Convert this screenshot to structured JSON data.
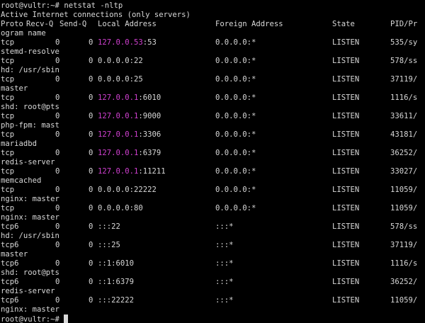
{
  "terminal": {
    "prompt": "root@vultr:~#",
    "command": "netstat -nltp",
    "title_line": "Active Internet connections (only servers)",
    "colors": {
      "background": "#000000",
      "foreground": "#d8d8d8",
      "local_ip_highlight": "#d040d0"
    }
  },
  "table": {
    "headers": {
      "proto": "Proto",
      "recvq": "Recv-Q",
      "sendq": "Send-Q",
      "local": "Local Address",
      "foreign": "Foreign Address",
      "state": "State",
      "pid": "PID/Pr",
      "pid_wrap": "ogram name"
    },
    "rows": [
      {
        "proto": "tcp",
        "recvq": "0",
        "sendq": "0",
        "local_ip": "127.0.0.53",
        "local_port": ":53",
        "foreign": "0.0.0.0:*",
        "state": "LISTEN",
        "pid": "535/sy",
        "wrap": "stemd-resolve"
      },
      {
        "proto": "tcp",
        "recvq": "0",
        "sendq": "0",
        "local_ip": "",
        "local_port": "0.0.0.0:22",
        "foreign": "0.0.0.0:*",
        "state": "LISTEN",
        "pid": "578/ss",
        "wrap": "hd: /usr/sbin"
      },
      {
        "proto": "tcp",
        "recvq": "0",
        "sendq": "0",
        "local_ip": "",
        "local_port": "0.0.0.0:25",
        "foreign": "0.0.0.0:*",
        "state": "LISTEN",
        "pid": "37119/",
        "wrap": "master"
      },
      {
        "proto": "tcp",
        "recvq": "0",
        "sendq": "0",
        "local_ip": "127.0.0.1",
        "local_port": ":6010",
        "foreign": "0.0.0.0:*",
        "state": "LISTEN",
        "pid": "1116/s",
        "wrap": "shd: root@pts"
      },
      {
        "proto": "tcp",
        "recvq": "0",
        "sendq": "0",
        "local_ip": "127.0.0.1",
        "local_port": ":9000",
        "foreign": "0.0.0.0:*",
        "state": "LISTEN",
        "pid": "33611/",
        "wrap": "php-fpm: mast"
      },
      {
        "proto": "tcp",
        "recvq": "0",
        "sendq": "0",
        "local_ip": "127.0.0.1",
        "local_port": ":3306",
        "foreign": "0.0.0.0:*",
        "state": "LISTEN",
        "pid": "43181/",
        "wrap": "mariadbd"
      },
      {
        "proto": "tcp",
        "recvq": "0",
        "sendq": "0",
        "local_ip": "127.0.0.1",
        "local_port": ":6379",
        "foreign": "0.0.0.0:*",
        "state": "LISTEN",
        "pid": "36252/",
        "wrap": "redis-server"
      },
      {
        "proto": "tcp",
        "recvq": "0",
        "sendq": "0",
        "local_ip": "127.0.0.1",
        "local_port": ":11211",
        "foreign": "0.0.0.0:*",
        "state": "LISTEN",
        "pid": "33027/",
        "wrap": "memcached"
      },
      {
        "proto": "tcp",
        "recvq": "0",
        "sendq": "0",
        "local_ip": "",
        "local_port": "0.0.0.0:22222",
        "foreign": "0.0.0.0:*",
        "state": "LISTEN",
        "pid": "11059/",
        "wrap": "nginx: master"
      },
      {
        "proto": "tcp",
        "recvq": "0",
        "sendq": "0",
        "local_ip": "",
        "local_port": "0.0.0.0:80",
        "foreign": "0.0.0.0:*",
        "state": "LISTEN",
        "pid": "11059/",
        "wrap": "nginx: master"
      },
      {
        "proto": "tcp6",
        "recvq": "0",
        "sendq": "0",
        "local_ip": "",
        "local_port": ":::22",
        "foreign": ":::*",
        "state": "LISTEN",
        "pid": "578/ss",
        "wrap": "hd: /usr/sbin"
      },
      {
        "proto": "tcp6",
        "recvq": "0",
        "sendq": "0",
        "local_ip": "",
        "local_port": ":::25",
        "foreign": ":::*",
        "state": "LISTEN",
        "pid": "37119/",
        "wrap": "master"
      },
      {
        "proto": "tcp6",
        "recvq": "0",
        "sendq": "0",
        "local_ip": "",
        "local_port": "::1:6010",
        "foreign": ":::*",
        "state": "LISTEN",
        "pid": "1116/s",
        "wrap": "shd: root@pts"
      },
      {
        "proto": "tcp6",
        "recvq": "0",
        "sendq": "0",
        "local_ip": "",
        "local_port": "::1:6379",
        "foreign": ":::*",
        "state": "LISTEN",
        "pid": "36252/",
        "wrap": "redis-server"
      },
      {
        "proto": "tcp6",
        "recvq": "0",
        "sendq": "0",
        "local_ip": "",
        "local_port": ":::22222",
        "foreign": ":::*",
        "state": "LISTEN",
        "pid": "11059/",
        "wrap": "nginx: master"
      }
    ]
  }
}
